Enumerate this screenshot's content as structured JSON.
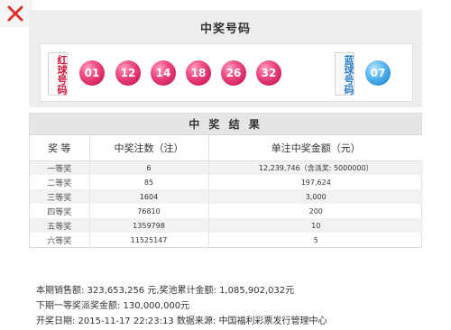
{
  "header": {
    "title": "中奖号码",
    "red_label": "红球号码",
    "blue_label": "蓝球号码"
  },
  "balls": {
    "red": [
      "01",
      "12",
      "14",
      "18",
      "26",
      "32"
    ],
    "blue": [
      "07"
    ]
  },
  "prize_table": {
    "title": "中 奖 结 果",
    "columns": [
      "奖  等",
      "中奖注数（注）",
      "单注中奖金额（元）"
    ],
    "rows": [
      {
        "level": "一等奖",
        "count": "6",
        "amount": "12,239,746（含派奖: 5000000）"
      },
      {
        "level": "二等奖",
        "count": "85",
        "amount": "197,624"
      },
      {
        "level": "三等奖",
        "count": "1604",
        "amount": "3,000"
      },
      {
        "level": "四等奖",
        "count": "76810",
        "amount": "200"
      },
      {
        "level": "五等奖",
        "count": "1359798",
        "amount": "10"
      },
      {
        "level": "六等奖",
        "count": "11525147",
        "amount": "5"
      }
    ]
  },
  "info": {
    "line1": "本期销售额: 323,653,256 元,奖池累计金额: 1,085,902,032元",
    "line2": "下期一等奖派奖金额: 130,000,000元",
    "line3": "开奖日期: 2015-11-17 22:23:13 数据来源: 中国福利彩票发行管理中心"
  },
  "colors": {
    "red_accent": "#d0143c",
    "blue_accent": "#2a7ec9",
    "corner_mark": "#d9302b"
  },
  "icons": {
    "corner": "x-mark-icon"
  }
}
